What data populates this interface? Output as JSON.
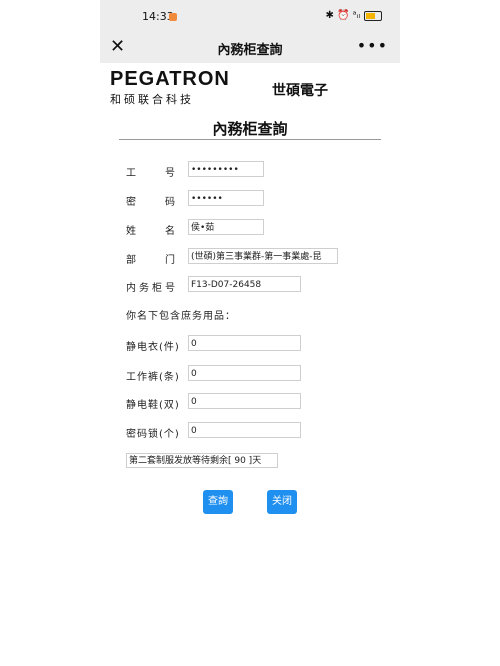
{
  "status": {
    "time": "14:33",
    "icons": "✱ ⏰ ᵃᵢₗ"
  },
  "nav": {
    "close": "✕",
    "title": "內務柜查詢",
    "more": "•••"
  },
  "logo": {
    "en": "PEGATRON",
    "cn": "和硕联合科技",
    "cn2": "世碩電子"
  },
  "form": {
    "title": "內務柜查詢",
    "fields": [
      {
        "label": "工　　号",
        "value": "•••••••••"
      },
      {
        "label": "密　　码",
        "value": "••••••"
      },
      {
        "label": "姓　　名",
        "value": "侯•茹"
      },
      {
        "label": "部　　门",
        "value": "(世碩)第三事業群-第一事業處-昆"
      },
      {
        "label": "内务柜号",
        "value": "F13-D07-26458"
      }
    ],
    "section": "你名下包含庶务用品：",
    "items": [
      {
        "label": "静电衣(件)",
        "value": "0"
      },
      {
        "label": "工作裤(条)",
        "value": "0"
      },
      {
        "label": "静电鞋(双)",
        "value": "0"
      },
      {
        "label": "密码锁(个)",
        "value": "0"
      }
    ],
    "note": "第二套制服发放等待剩余[ 90 ]天"
  },
  "buttons": {
    "query": "查詢",
    "close": "关闭"
  },
  "colors": {
    "button": "#1f8ff0",
    "bar": "#ededed"
  }
}
